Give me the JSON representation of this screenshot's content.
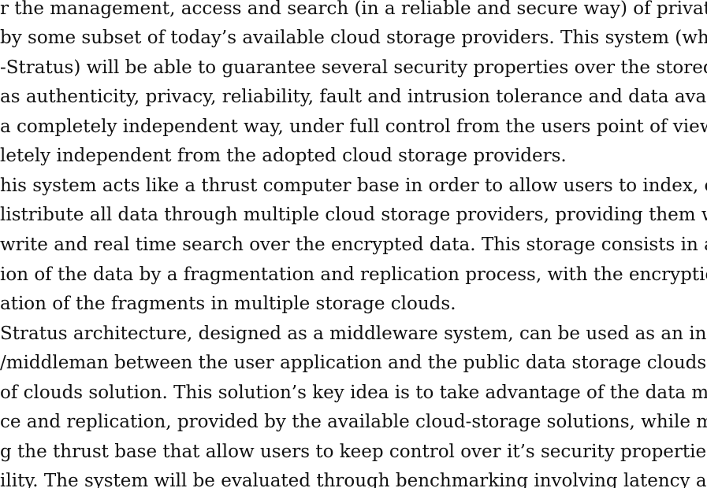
{
  "document": {
    "lines": [
      "r the management, access and search (in a reliable and secure way) of private dat",
      "by some subset of today’s available cloud storage providers. This system (which w",
      "-Stratus) will be able to guarantee several security properties over the stored data",
      "as authenticity, privacy, reliability, fault and intrusion tolerance and data availabi",
      " a completely independent way, under full control from the users point of view an",
      "letely independent from the adopted cloud storage providers.",
      "his system acts like a thrust computer base in order to allow users to index, encryp",
      "listribute all data through multiple cloud storage providers, providing them wit",
      " write and real time search over the encrypted data. This storage consists in a dis",
      "ion of the data by a fragmentation and replication process, with the encryption an",
      "ation of the fragments in multiple storage clouds.",
      "Stratus architecture, designed as a middleware system, can be used as an interme",
      "/middleman between the user application and the public data storage clouds, in",
      " of clouds solution. This solution’s key idea is to take advantage of the data main",
      "ce and replication, provided by the available cloud-storage solutions, while main",
      "g the thrust base that allow users to keep control over it’s security properties an",
      "ility. The system will be evaluated through benchmarking involving latency an"
    ]
  }
}
